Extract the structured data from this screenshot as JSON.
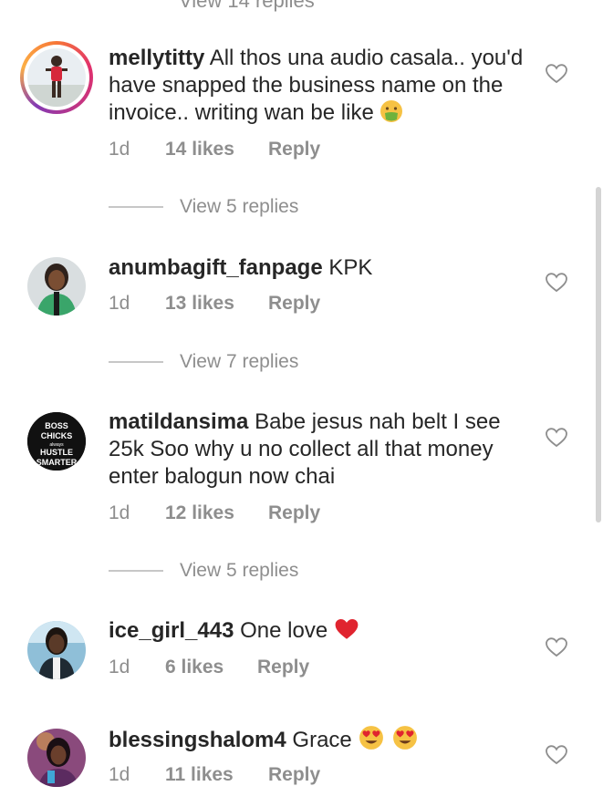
{
  "top_view_replies": "View 14 replies",
  "comments": [
    {
      "username": "mellytitty",
      "text": "All thos una audio casala.. you'd have snapped the business name on the invoice.. writing wan be like",
      "emoji": "nauseated-face-emoji",
      "time": "1d",
      "likes": "14 likes",
      "reply": "Reply",
      "view_replies": "View 5 replies"
    },
    {
      "username": "anumbagift_fanpage",
      "text": "KPK",
      "time": "1d",
      "likes": "13 likes",
      "reply": "Reply",
      "view_replies": "View 7 replies"
    },
    {
      "username": "matildansima",
      "text": "Babe jesus nah belt I see 25k Soo why u no collect all that money enter  balogun now chai",
      "time": "1d",
      "likes": "12 likes",
      "reply": "Reply",
      "view_replies": "View 5 replies",
      "avatar_text": [
        "BOSS",
        "CHICKS",
        "always",
        "HUSTLE",
        "SMARTER"
      ]
    },
    {
      "username": "ice_girl_443",
      "text": "One love",
      "emoji": "red-heart-emoji",
      "time": "1d",
      "likes": "6 likes",
      "reply": "Reply"
    },
    {
      "username": "blessingshalom4",
      "text": "Grace",
      "emoji": "heart-eyes-emoji",
      "time": "1d",
      "likes": "11 likes",
      "reply": "Reply"
    }
  ],
  "colors": {
    "text": "#262626",
    "secondary": "#8e8e8e",
    "divider": "#c7c7c7",
    "emoji_red": "#e0242f",
    "emoji_yellow": "#f6c244"
  }
}
